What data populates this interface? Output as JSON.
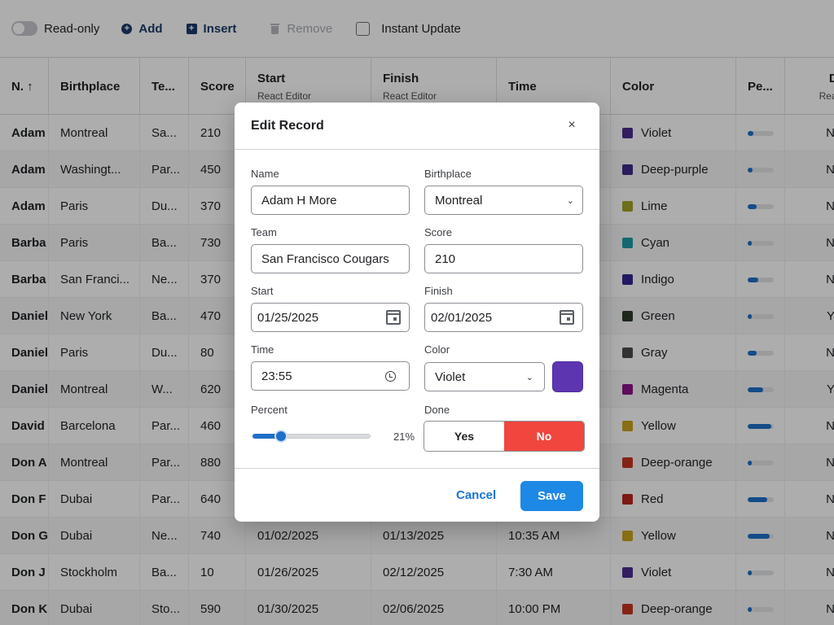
{
  "toolbar": {
    "readonly_label": "Read-only",
    "add_label": "Add",
    "insert_label": "Insert",
    "remove_label": "Remove",
    "instant_update_label": "Instant Update"
  },
  "grid": {
    "columns": [
      {
        "label": "N. ↑",
        "sub": ""
      },
      {
        "label": "Birthplace",
        "sub": ""
      },
      {
        "label": "Te...",
        "sub": ""
      },
      {
        "label": "Score",
        "sub": ""
      },
      {
        "label": "Start",
        "sub": "React Editor"
      },
      {
        "label": "Finish",
        "sub": "React Editor"
      },
      {
        "label": "Time",
        "sub": ""
      },
      {
        "label": "Color",
        "sub": ""
      },
      {
        "label": "Pe...",
        "sub": ""
      },
      {
        "label": "Da",
        "sub": "React"
      }
    ],
    "rows": [
      {
        "name": "Adam",
        "birthplace": "Montreal",
        "team": "Sa...",
        "score": "210",
        "start": "",
        "finish": "",
        "time": "",
        "color": "Violet",
        "color_hex": "#4a2d8f",
        "percent": 0.21,
        "done": "N"
      },
      {
        "name": "Adam",
        "birthplace": "Washingt...",
        "team": "Par...",
        "score": "450",
        "start": "",
        "finish": "",
        "time": "",
        "color": "Deep-purple",
        "color_hex": "#3e2a8a",
        "percent": 0.18,
        "done": "N"
      },
      {
        "name": "Adam",
        "birthplace": "Paris",
        "team": "Du...",
        "score": "370",
        "start": "",
        "finish": "",
        "time": "",
        "color": "Lime",
        "color_hex": "#a3a32a",
        "percent": 0.35,
        "done": "N"
      },
      {
        "name": "Barba",
        "birthplace": "Paris",
        "team": "Ba...",
        "score": "730",
        "start": "",
        "finish": "",
        "time": "",
        "color": "Cyan",
        "color_hex": "#1f9aa6",
        "percent": 0.15,
        "done": "N"
      },
      {
        "name": "Barba",
        "birthplace": "San Franci...",
        "team": "Ne...",
        "score": "370",
        "start": "",
        "finish": "",
        "time": "",
        "color": "Indigo",
        "color_hex": "#33278f",
        "percent": 0.4,
        "done": "N"
      },
      {
        "name": "Daniel",
        "birthplace": "New York",
        "team": "Ba...",
        "score": "470",
        "start": "",
        "finish": "",
        "time": "",
        "color": "Green",
        "color_hex": "#2e3a2c",
        "percent": 0.15,
        "done": "Y"
      },
      {
        "name": "Daniel",
        "birthplace": "Paris",
        "team": "Du...",
        "score": "80",
        "start": "",
        "finish": "",
        "time": "",
        "color": "Gray",
        "color_hex": "#4a4a4a",
        "percent": 0.35,
        "done": "N"
      },
      {
        "name": "Daniel",
        "birthplace": "Montreal",
        "team": "W...",
        "score": "620",
        "start": "",
        "finish": "",
        "time": "",
        "color": "Magenta",
        "color_hex": "#8a1488",
        "percent": 0.6,
        "done": "Y"
      },
      {
        "name": "David",
        "birthplace": "Barcelona",
        "team": "Par...",
        "score": "460",
        "start": "",
        "finish": "",
        "time": "",
        "color": "Yellow",
        "color_hex": "#c9a31f",
        "percent": 0.92,
        "done": "N"
      },
      {
        "name": "Don A",
        "birthplace": "Montreal",
        "team": "Par...",
        "score": "880",
        "start": "",
        "finish": "",
        "time": "",
        "color": "Deep-orange",
        "color_hex": "#c4361f",
        "percent": 0.15,
        "done": "N"
      },
      {
        "name": "Don F J",
        "birthplace": "Dubai",
        "team": "Par...",
        "score": "640",
        "start": "",
        "finish": "",
        "time": "",
        "color": "Red",
        "color_hex": "#b8271f",
        "percent": 0.75,
        "done": "N"
      },
      {
        "name": "Don G",
        "birthplace": "Dubai",
        "team": "Ne...",
        "score": "740",
        "start": "01/02/2025",
        "finish": "01/13/2025",
        "time": "10:35 AM",
        "color": "Yellow",
        "color_hex": "#c9a31f",
        "percent": 0.85,
        "done": "N"
      },
      {
        "name": "Don J T",
        "birthplace": "Stockholm",
        "team": "Ba...",
        "score": "10",
        "start": "01/26/2025",
        "finish": "02/12/2025",
        "time": "7:30 AM",
        "color": "Violet",
        "color_hex": "#4a2d8f",
        "percent": 0.15,
        "done": "N"
      },
      {
        "name": "Don K",
        "birthplace": "Dubai",
        "team": "Sto...",
        "score": "590",
        "start": "01/30/2025",
        "finish": "02/06/2025",
        "time": "10:00 PM",
        "color": "Deep-orange",
        "color_hex": "#c4361f",
        "percent": 0.15,
        "done": "N"
      }
    ]
  },
  "dialog": {
    "title": "Edit Record",
    "close_glyph": "×",
    "name_label": "Name",
    "name_value": "Adam H More",
    "birthplace_label": "Birthplace",
    "birthplace_value": "Montreal",
    "team_label": "Team",
    "team_value": "San Francisco Cougars",
    "score_label": "Score",
    "score_value": "210",
    "start_label": "Start",
    "start_value": "01/25/2025",
    "finish_label": "Finish",
    "finish_value": "02/01/2025",
    "time_label": "Time",
    "time_value": "23:55",
    "color_label": "Color",
    "color_value": "Violet",
    "color_hex": "#5e35b1",
    "percent_label": "Percent",
    "percent_value": 0.21,
    "percent_text": "21%",
    "done_label": "Done",
    "done_yes": "Yes",
    "done_no": "No",
    "done_selected": "No",
    "cancel_label": "Cancel",
    "save_label": "Save"
  }
}
